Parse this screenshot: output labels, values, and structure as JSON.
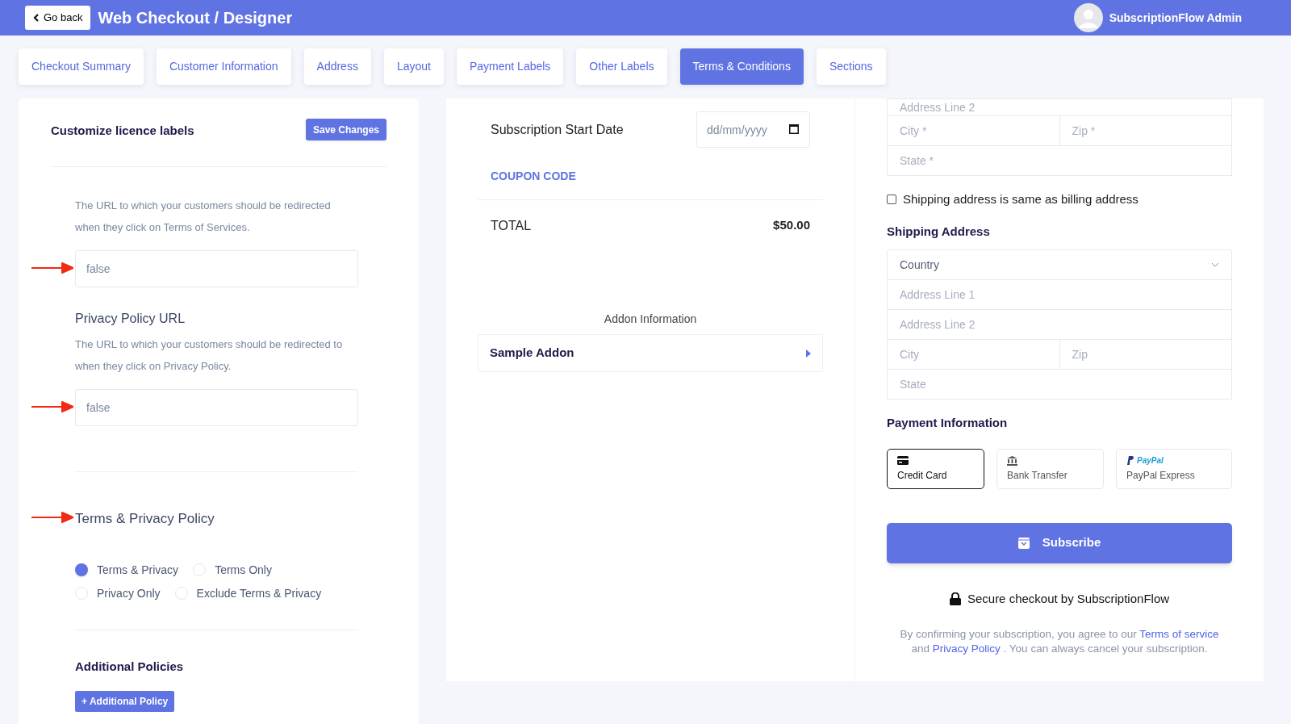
{
  "header": {
    "back_button": "Go back",
    "title": "Web Checkout / Designer",
    "user": "SubscriptionFlow Admin"
  },
  "tabs": [
    {
      "label": "Checkout Summary",
      "selected": false
    },
    {
      "label": "Customer Information",
      "selected": false
    },
    {
      "label": "Address",
      "selected": false
    },
    {
      "label": "Layout",
      "selected": false
    },
    {
      "label": "Payment Labels",
      "selected": false
    },
    {
      "label": "Other Labels",
      "selected": false
    },
    {
      "label": "Terms & Conditions",
      "selected": true
    },
    {
      "label": "Sections",
      "selected": false
    }
  ],
  "licence_panel": {
    "title": "Customize licence labels",
    "save_button": "Save Changes",
    "terms_url": {
      "description": "The URL to which your customers should be redirected when they click on Terms of Services.",
      "value": "false"
    },
    "privacy_url": {
      "label": "Privacy Policy URL",
      "description": "The URL to which your customers should be redirected to when they click on Privacy Policy.",
      "value": "false"
    },
    "policy": {
      "label": "Terms & Privacy Policy",
      "options": [
        {
          "label": "Terms & Privacy",
          "selected": true
        },
        {
          "label": "Terms Only",
          "selected": false
        },
        {
          "label": "Privacy Only",
          "selected": false
        },
        {
          "label": "Exclude Terms & Privacy",
          "selected": false
        }
      ]
    },
    "additional": {
      "title": "Additional Policies",
      "button": "+ Additional Policy"
    }
  },
  "preview": {
    "start_date": {
      "label": "Subscription Start Date",
      "placeholder": "dd/mm/yyyy"
    },
    "coupon_link": "COUPON CODE",
    "total": {
      "label": "TOTAL",
      "amount": "$50.00"
    },
    "addon_heading": "Addon Information",
    "addons": [
      {
        "name": "Sample Addon"
      }
    ],
    "billing_rows": [
      [
        {
          "placeholder": "Address Line 2"
        }
      ],
      [
        {
          "placeholder": "City *"
        },
        {
          "placeholder": "Zip *"
        }
      ],
      [
        {
          "placeholder": "State *"
        }
      ]
    ],
    "same_as_billing": {
      "label": "Shipping address is same as billing address",
      "checked": false
    },
    "shipping": {
      "title": "Shipping Address",
      "country": "Country",
      "rows": [
        [
          {
            "placeholder": "Address Line 1"
          }
        ],
        [
          {
            "placeholder": "Address Line 2"
          }
        ],
        [
          {
            "placeholder": "City"
          },
          {
            "placeholder": "Zip"
          }
        ],
        [
          {
            "placeholder": "State"
          }
        ]
      ]
    },
    "payment": {
      "title": "Payment Information",
      "methods": [
        {
          "kind": "card",
          "label": "Credit Card",
          "selected": true
        },
        {
          "kind": "bank",
          "label": "Bank Transfer",
          "selected": false
        },
        {
          "kind": "paypal",
          "label": "PayPal Express",
          "brand": "PayPal",
          "selected": false
        }
      ]
    },
    "subscribe_button": "Subscribe",
    "secure_text": "Secure checkout by SubscriptionFlow",
    "legal": [
      {
        "kind": "text",
        "text": "By confirming your subscription, you agree to our"
      },
      {
        "kind": "link",
        "text": "Terms of service"
      },
      {
        "kind": "text",
        "text": "and"
      },
      {
        "kind": "link",
        "text": "Privacy Policy"
      },
      {
        "kind": "text",
        "text": ". You can always cancel your subscription."
      }
    ]
  }
}
